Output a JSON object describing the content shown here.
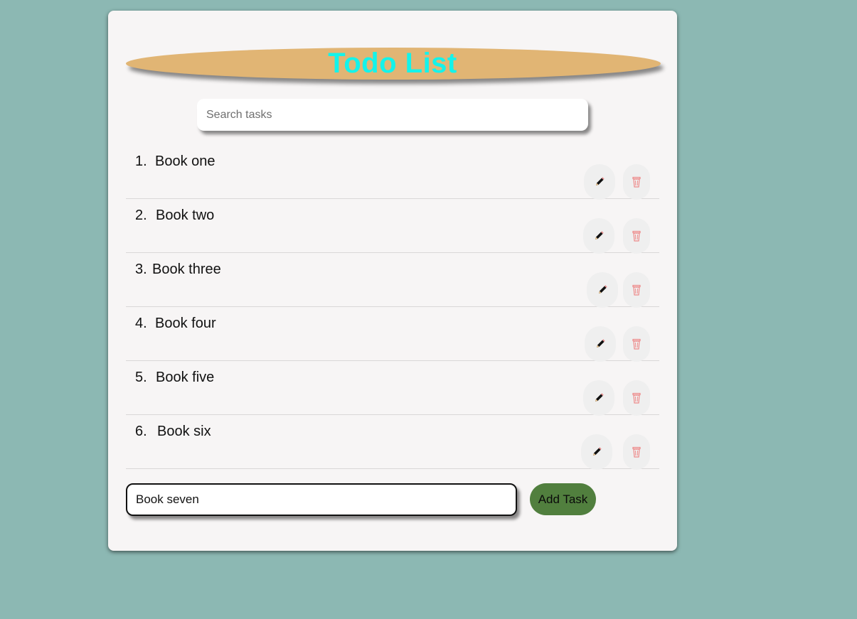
{
  "header": {
    "title": "Todo List"
  },
  "search": {
    "placeholder": "Search tasks",
    "value": ""
  },
  "tasks": [
    {
      "number": "1.",
      "text": "Book one"
    },
    {
      "number": "2.",
      "text": "Book two"
    },
    {
      "number": "3.",
      "text": "Book three"
    },
    {
      "number": "4.",
      "text": "Book four"
    },
    {
      "number": "5.",
      "text": "Book five"
    },
    {
      "number": "6.",
      "text": "Book six"
    }
  ],
  "task_actions": {
    "edit_icon": "pencil-icon",
    "delete_icon": "trash-icon"
  },
  "new_task": {
    "value": "Book seven",
    "add_label": "Add Task"
  },
  "colors": {
    "background": "#8cb8b3",
    "card": "#f7f5f5",
    "title_banner": "#e1b574",
    "title_text": "#14f3ea",
    "add_button": "#517f3e",
    "delete_icon": "#f08c8c"
  }
}
